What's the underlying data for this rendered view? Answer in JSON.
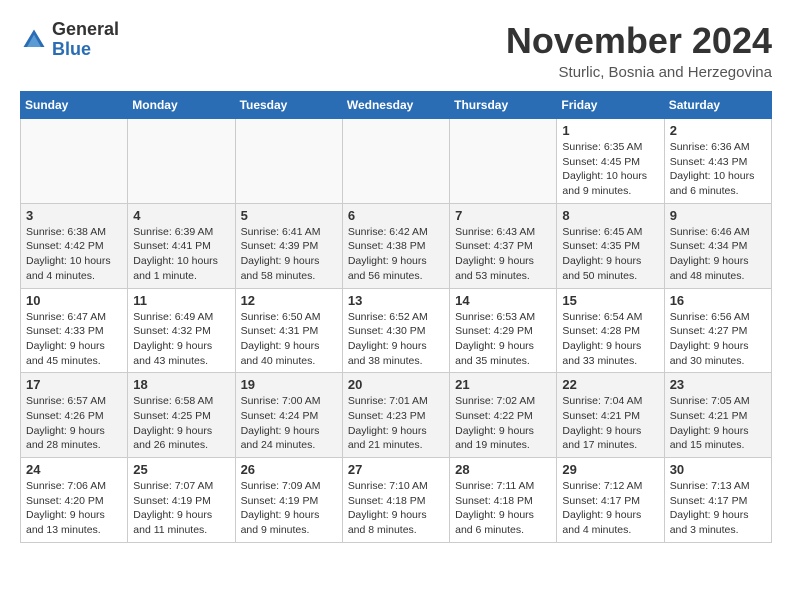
{
  "header": {
    "logo_line1": "General",
    "logo_line2": "Blue",
    "month_title": "November 2024",
    "location": "Sturlic, Bosnia and Herzegovina"
  },
  "days_of_week": [
    "Sunday",
    "Monday",
    "Tuesday",
    "Wednesday",
    "Thursday",
    "Friday",
    "Saturday"
  ],
  "weeks": [
    [
      {
        "day": "",
        "info": ""
      },
      {
        "day": "",
        "info": ""
      },
      {
        "day": "",
        "info": ""
      },
      {
        "day": "",
        "info": ""
      },
      {
        "day": "",
        "info": ""
      },
      {
        "day": "1",
        "info": "Sunrise: 6:35 AM\nSunset: 4:45 PM\nDaylight: 10 hours and 9 minutes."
      },
      {
        "day": "2",
        "info": "Sunrise: 6:36 AM\nSunset: 4:43 PM\nDaylight: 10 hours and 6 minutes."
      }
    ],
    [
      {
        "day": "3",
        "info": "Sunrise: 6:38 AM\nSunset: 4:42 PM\nDaylight: 10 hours and 4 minutes."
      },
      {
        "day": "4",
        "info": "Sunrise: 6:39 AM\nSunset: 4:41 PM\nDaylight: 10 hours and 1 minute."
      },
      {
        "day": "5",
        "info": "Sunrise: 6:41 AM\nSunset: 4:39 PM\nDaylight: 9 hours and 58 minutes."
      },
      {
        "day": "6",
        "info": "Sunrise: 6:42 AM\nSunset: 4:38 PM\nDaylight: 9 hours and 56 minutes."
      },
      {
        "day": "7",
        "info": "Sunrise: 6:43 AM\nSunset: 4:37 PM\nDaylight: 9 hours and 53 minutes."
      },
      {
        "day": "8",
        "info": "Sunrise: 6:45 AM\nSunset: 4:35 PM\nDaylight: 9 hours and 50 minutes."
      },
      {
        "day": "9",
        "info": "Sunrise: 6:46 AM\nSunset: 4:34 PM\nDaylight: 9 hours and 48 minutes."
      }
    ],
    [
      {
        "day": "10",
        "info": "Sunrise: 6:47 AM\nSunset: 4:33 PM\nDaylight: 9 hours and 45 minutes."
      },
      {
        "day": "11",
        "info": "Sunrise: 6:49 AM\nSunset: 4:32 PM\nDaylight: 9 hours and 43 minutes."
      },
      {
        "day": "12",
        "info": "Sunrise: 6:50 AM\nSunset: 4:31 PM\nDaylight: 9 hours and 40 minutes."
      },
      {
        "day": "13",
        "info": "Sunrise: 6:52 AM\nSunset: 4:30 PM\nDaylight: 9 hours and 38 minutes."
      },
      {
        "day": "14",
        "info": "Sunrise: 6:53 AM\nSunset: 4:29 PM\nDaylight: 9 hours and 35 minutes."
      },
      {
        "day": "15",
        "info": "Sunrise: 6:54 AM\nSunset: 4:28 PM\nDaylight: 9 hours and 33 minutes."
      },
      {
        "day": "16",
        "info": "Sunrise: 6:56 AM\nSunset: 4:27 PM\nDaylight: 9 hours and 30 minutes."
      }
    ],
    [
      {
        "day": "17",
        "info": "Sunrise: 6:57 AM\nSunset: 4:26 PM\nDaylight: 9 hours and 28 minutes."
      },
      {
        "day": "18",
        "info": "Sunrise: 6:58 AM\nSunset: 4:25 PM\nDaylight: 9 hours and 26 minutes."
      },
      {
        "day": "19",
        "info": "Sunrise: 7:00 AM\nSunset: 4:24 PM\nDaylight: 9 hours and 24 minutes."
      },
      {
        "day": "20",
        "info": "Sunrise: 7:01 AM\nSunset: 4:23 PM\nDaylight: 9 hours and 21 minutes."
      },
      {
        "day": "21",
        "info": "Sunrise: 7:02 AM\nSunset: 4:22 PM\nDaylight: 9 hours and 19 minutes."
      },
      {
        "day": "22",
        "info": "Sunrise: 7:04 AM\nSunset: 4:21 PM\nDaylight: 9 hours and 17 minutes."
      },
      {
        "day": "23",
        "info": "Sunrise: 7:05 AM\nSunset: 4:21 PM\nDaylight: 9 hours and 15 minutes."
      }
    ],
    [
      {
        "day": "24",
        "info": "Sunrise: 7:06 AM\nSunset: 4:20 PM\nDaylight: 9 hours and 13 minutes."
      },
      {
        "day": "25",
        "info": "Sunrise: 7:07 AM\nSunset: 4:19 PM\nDaylight: 9 hours and 11 minutes."
      },
      {
        "day": "26",
        "info": "Sunrise: 7:09 AM\nSunset: 4:19 PM\nDaylight: 9 hours and 9 minutes."
      },
      {
        "day": "27",
        "info": "Sunrise: 7:10 AM\nSunset: 4:18 PM\nDaylight: 9 hours and 8 minutes."
      },
      {
        "day": "28",
        "info": "Sunrise: 7:11 AM\nSunset: 4:18 PM\nDaylight: 9 hours and 6 minutes."
      },
      {
        "day": "29",
        "info": "Sunrise: 7:12 AM\nSunset: 4:17 PM\nDaylight: 9 hours and 4 minutes."
      },
      {
        "day": "30",
        "info": "Sunrise: 7:13 AM\nSunset: 4:17 PM\nDaylight: 9 hours and 3 minutes."
      }
    ]
  ]
}
